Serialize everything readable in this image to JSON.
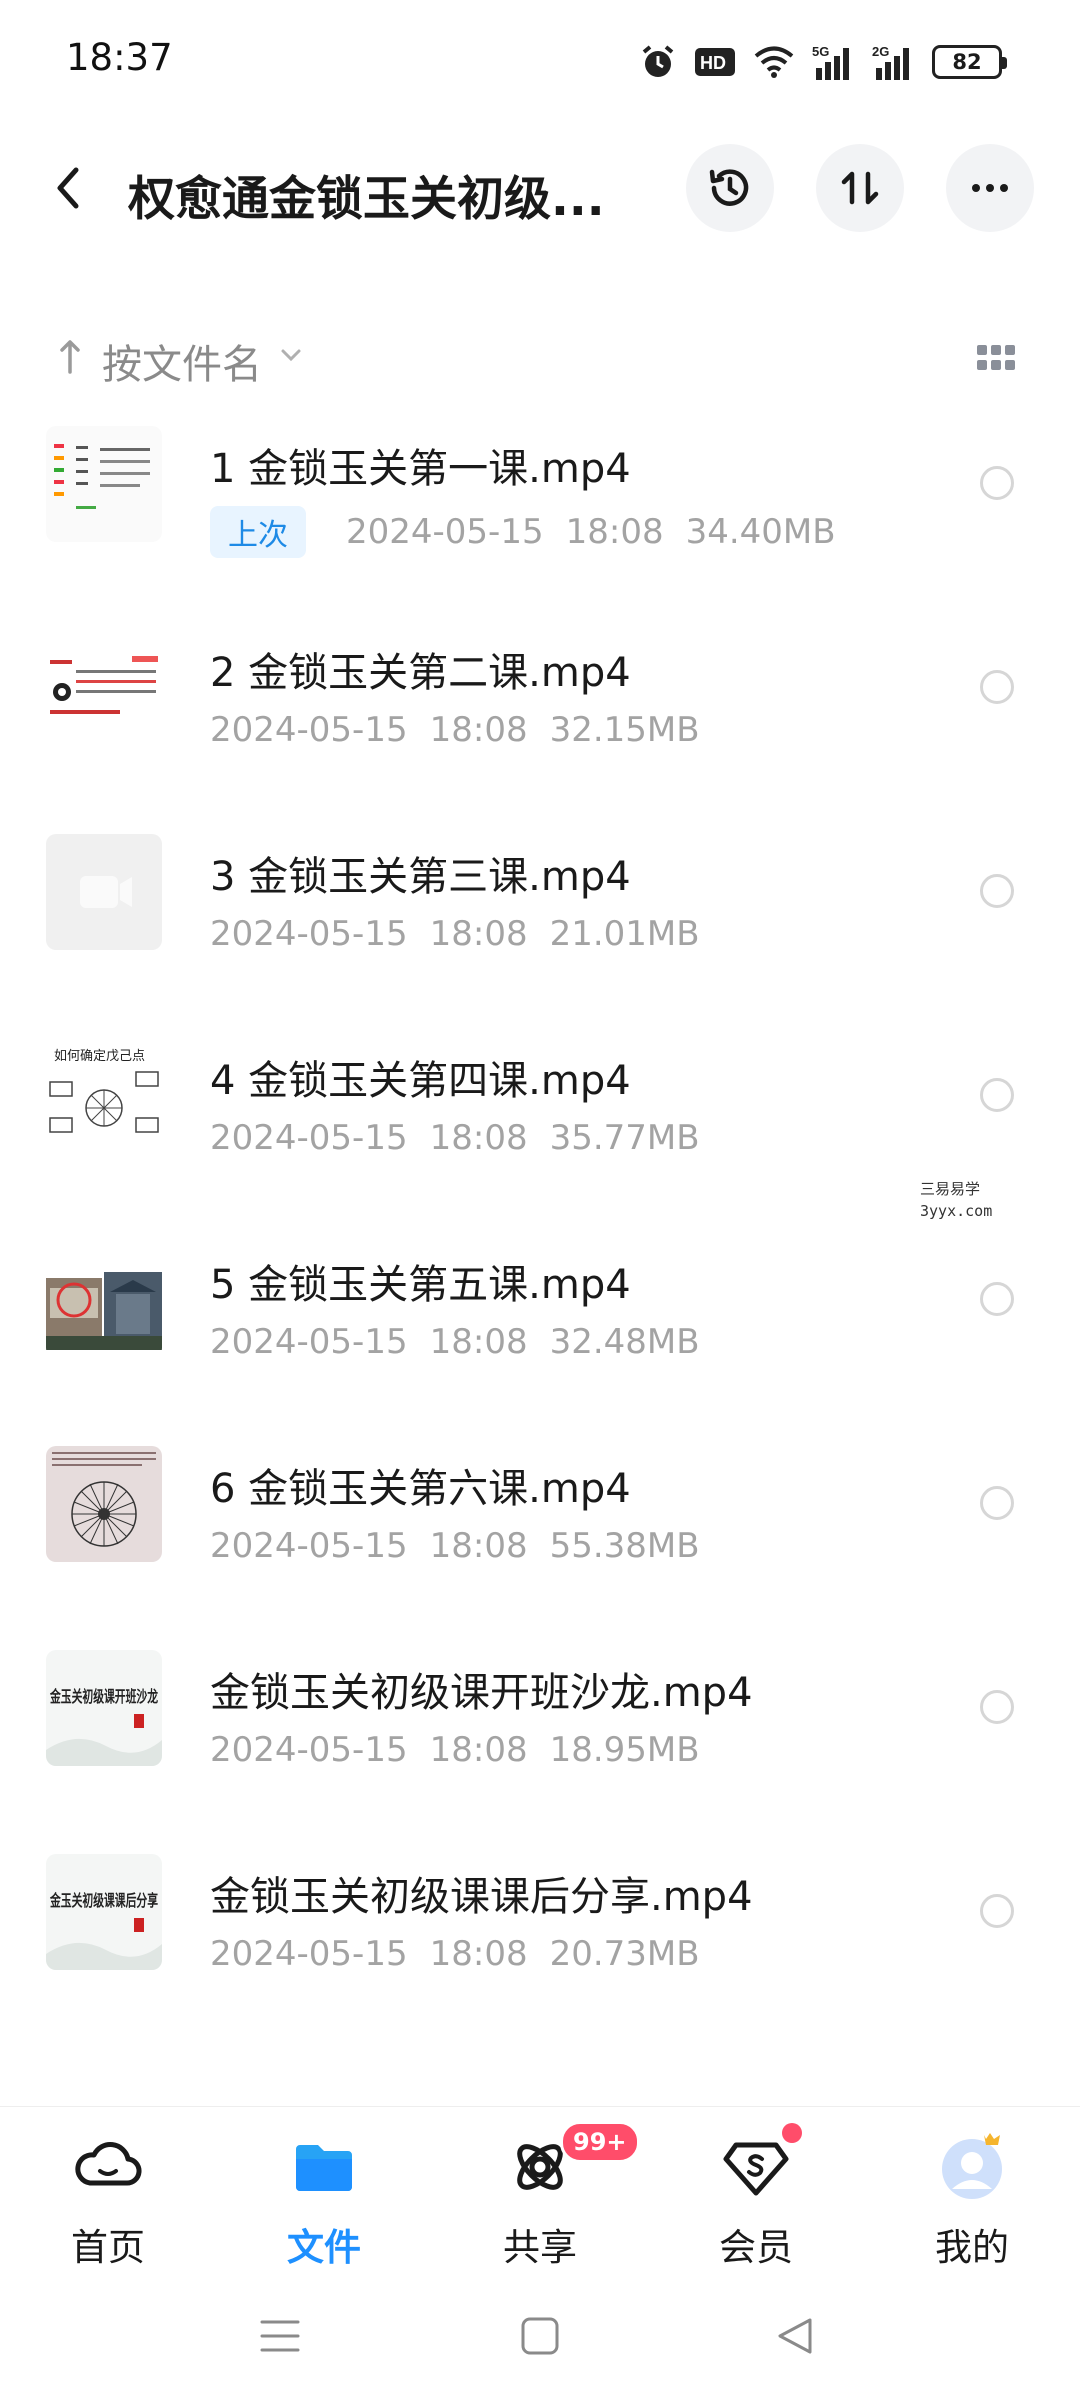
{
  "status": {
    "time": "18:37",
    "battery": "82",
    "hd": "HD",
    "net1": "5G",
    "net2": "2G"
  },
  "header": {
    "title": "权愈通金锁玉关初级..."
  },
  "sort": {
    "label": "按文件名"
  },
  "files": [
    {
      "name": "1 金锁玉关第一课.mp4",
      "badge": "上次",
      "date": "2024-05-15",
      "time": "18:08",
      "size": "34.40MB"
    },
    {
      "name": "2 金锁玉关第二课.mp4",
      "date": "2024-05-15",
      "time": "18:08",
      "size": "32.15MB"
    },
    {
      "name": "3 金锁玉关第三课.mp4",
      "date": "2024-05-15",
      "time": "18:08",
      "size": "21.01MB"
    },
    {
      "name": "4 金锁玉关第四课.mp4",
      "date": "2024-05-15",
      "time": "18:08",
      "size": "35.77MB",
      "thumb_text": "如何确定戊己点"
    },
    {
      "name": "5 金锁玉关第五课.mp4",
      "date": "2024-05-15",
      "time": "18:08",
      "size": "32.48MB"
    },
    {
      "name": "6 金锁玉关第六课.mp4",
      "date": "2024-05-15",
      "time": "18:08",
      "size": "55.38MB"
    },
    {
      "name": "金锁玉关初级课开班沙龙.mp4",
      "date": "2024-05-15",
      "time": "18:08",
      "size": "18.95MB",
      "thumb_text": "金玉关初级课开班沙龙"
    },
    {
      "name": "金锁玉关初级课课后分享.mp4",
      "date": "2024-05-15",
      "time": "18:08",
      "size": "20.73MB",
      "thumb_text": "金玉关初级课课后分享"
    }
  ],
  "watermark": {
    "line1": "三易易学",
    "line2": "3yyx.com"
  },
  "tabs": [
    {
      "label": "首页"
    },
    {
      "label": "文件"
    },
    {
      "label": "共享",
      "badge": "99+"
    },
    {
      "label": "会员"
    },
    {
      "label": "我的"
    }
  ],
  "colors": {
    "accent": "#1e90ff",
    "badge": "#ff4d6a"
  }
}
